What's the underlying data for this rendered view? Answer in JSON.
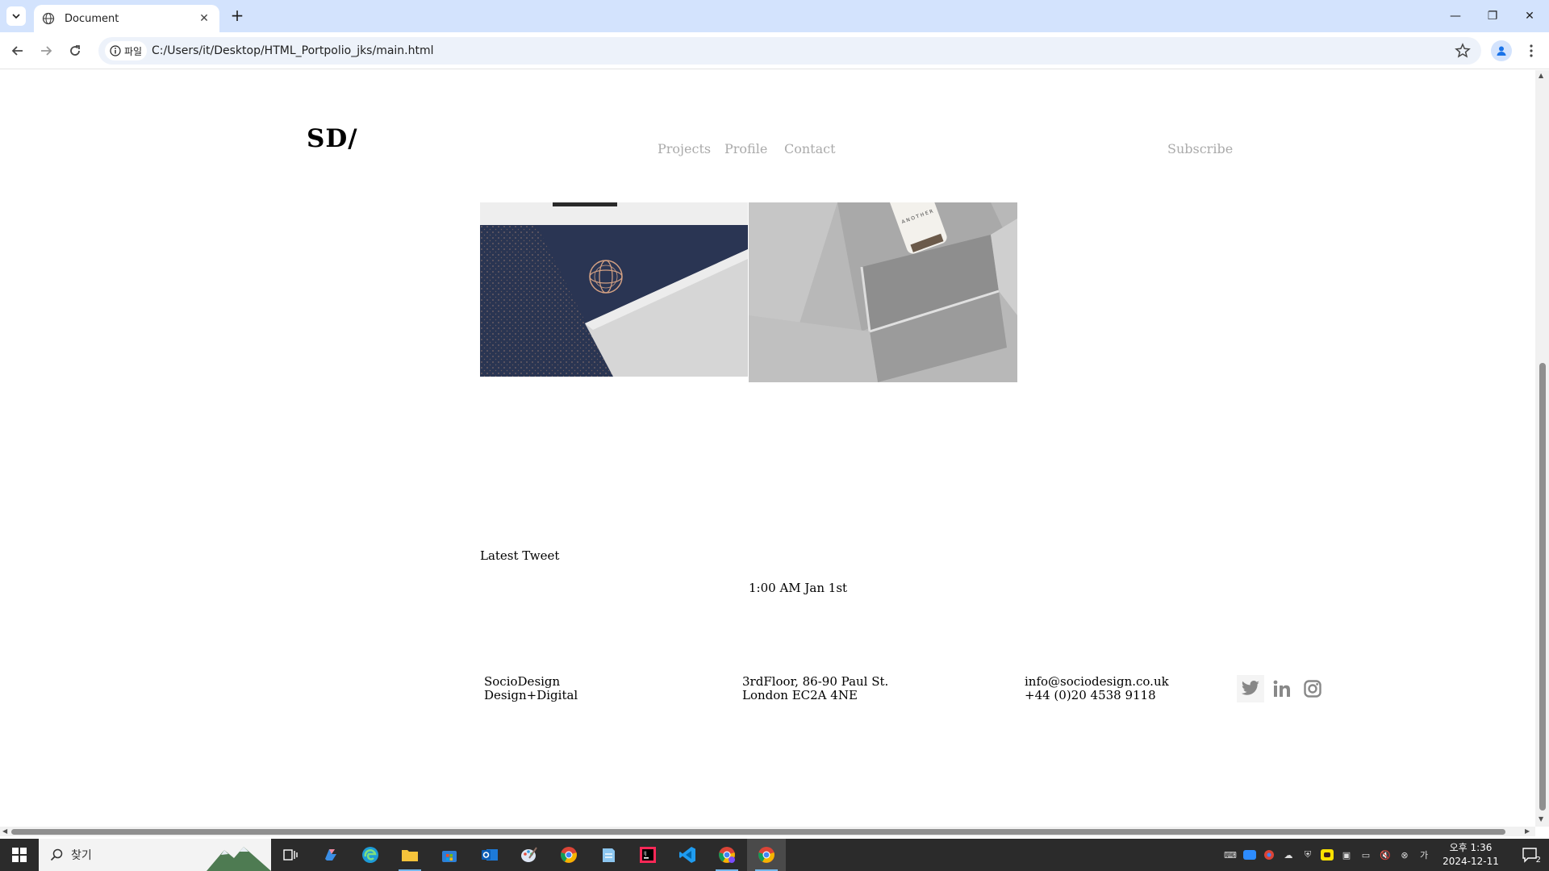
{
  "browser": {
    "tab_title": "Document",
    "new_tab": "+",
    "address_prefix": "파일",
    "url": "C:/Users/it/Desktop/HTML_Portpolio_jks/main.html"
  },
  "site": {
    "logo": "SD/",
    "nav": [
      {
        "label": "Projects"
      },
      {
        "label": "Profile"
      },
      {
        "label": "Contact"
      }
    ],
    "subscribe": "Subscribe"
  },
  "tweets": {
    "heading": "Latest Tweet",
    "time": "1:00 AM Jan 1st"
  },
  "footer": {
    "company": {
      "line1": "SocioDesign",
      "line2": "Design+Digital"
    },
    "address": {
      "line1": "3rdFloor, 86-90 Paul St.",
      "line2": "London EC2A 4NE"
    },
    "contact": {
      "line1": "info@sociodesign.co.uk",
      "line2": "+44 (0)20 4538 9118"
    },
    "social": [
      "twitter-icon",
      "linkedin-icon",
      "instagram-icon"
    ]
  },
  "photos": {
    "bottle_label": "A N O T H E R"
  },
  "taskbar": {
    "search_placeholder": "찾기",
    "time": "오후 1:36",
    "date": "2024-12-11",
    "notification_count": "2"
  }
}
